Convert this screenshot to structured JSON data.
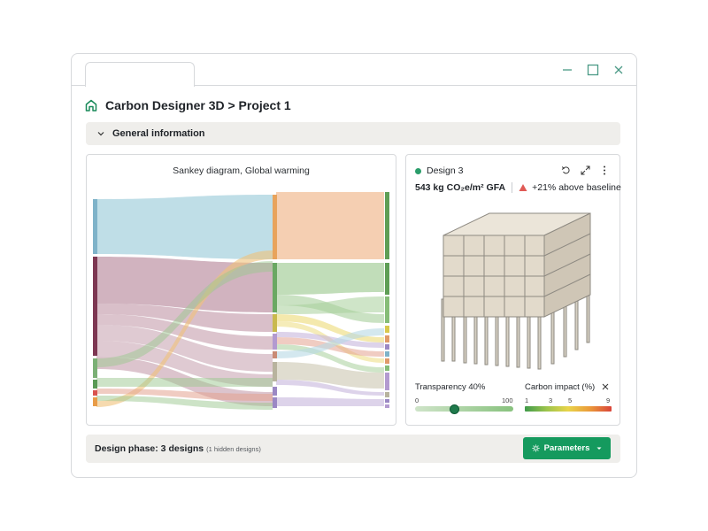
{
  "window": {
    "tab_label": "",
    "controls": [
      "minimize-icon",
      "maximize-icon",
      "close-icon"
    ]
  },
  "header": {
    "title": "Carbon Designer 3D > Project 1",
    "icon": "home-icon"
  },
  "general_section": {
    "label": "General information",
    "icon": "chevron-down-icon"
  },
  "sankey": {
    "title": "Sankey diagram, Global warming"
  },
  "design_panel": {
    "name": "Design 3",
    "status_color": "#2a9d6a",
    "metric": "543 kg CO₂e/m² GFA",
    "delta": "+21% above baseline",
    "delta_color": "#e05a55",
    "icons": [
      "undo-icon",
      "expand-icon",
      "more-vertical-icon"
    ]
  },
  "transparency": {
    "label": "Transparency 40%",
    "min": "0",
    "max": "100",
    "value": 40
  },
  "carbon_impact": {
    "label": "Carbon impact (%)",
    "ticks": [
      "1",
      "3",
      "5",
      "9"
    ],
    "colors": [
      "#3f9a4a",
      "#9cc44c",
      "#e9d44a",
      "#eb9a3a",
      "#d9443a"
    ]
  },
  "footer": {
    "phase_label": "Design phase: 3 designs",
    "hidden_note": "(1 hidden designs)",
    "button_label": "Parameters",
    "button_color": "#159a5e"
  }
}
